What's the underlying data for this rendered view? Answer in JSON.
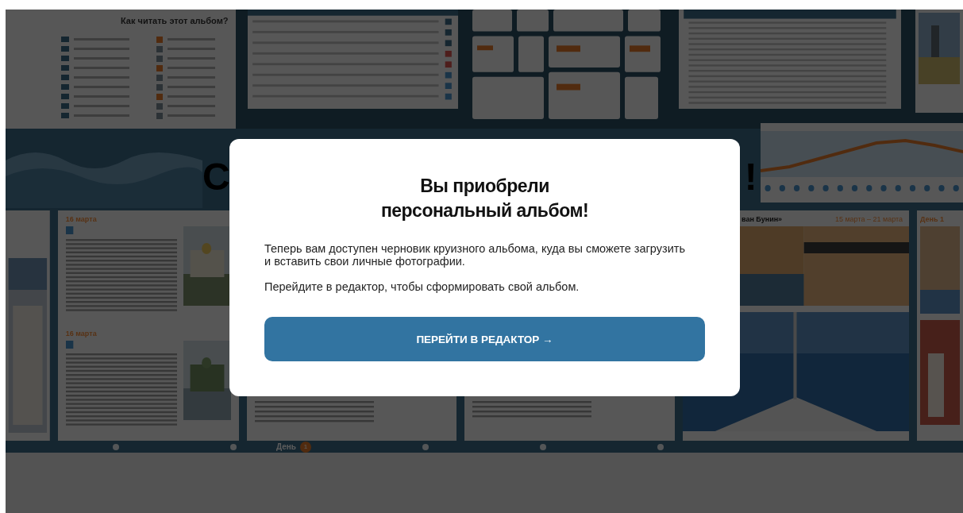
{
  "background": {
    "guide_title": "Как читать этот альбом?",
    "banner_heading": [
      "С",
      "!"
    ],
    "pages": [
      {
        "date": "16 марта"
      },
      {
        "date": "16 марта"
      }
    ],
    "cruise_title": "ван Бунин»",
    "cruise_dates": "15 марта – 21 марта",
    "day_label": "День 1",
    "nav": {
      "label": "День",
      "day": "1"
    }
  },
  "dialog": {
    "title": "Вы приобрели\nперсональный альбом!",
    "paragraphs": [
      "Теперь вам доступен черновик круизного альбома, куда вы сможете загрузить и вставить свои личные фотографии.",
      "Перейдите в редактор, чтобы сформировать свой альбом."
    ],
    "button": "ПЕРЕЙТИ В РЕДАКТОР →"
  }
}
